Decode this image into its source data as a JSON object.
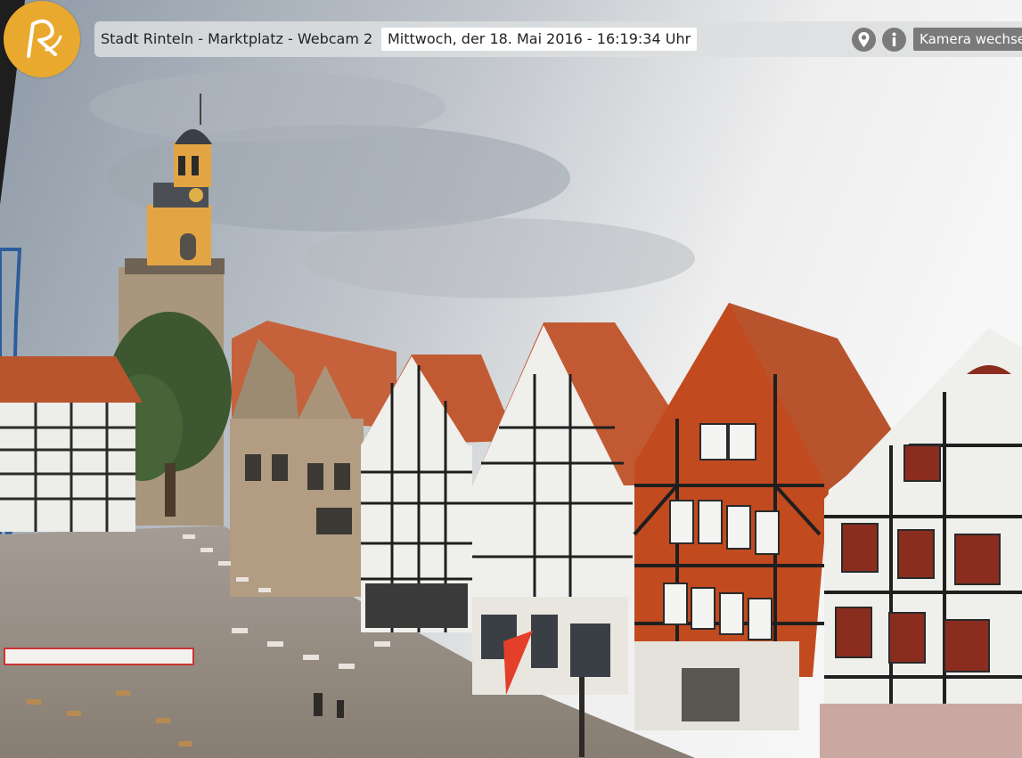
{
  "window": {
    "camera_title": "Stadt Rinteln - Marktplatz - Webcam 2",
    "timestamp": "Mittwoch, der 18. Mai 2016 - 16:19:34 Uhr"
  },
  "controls": {
    "switch_camera_label": "Kamera wechseln",
    "location_icon": "map-pin-icon",
    "info_icon": "info-icon"
  },
  "branding": {
    "logo_color": "#e9a92f"
  },
  "scene": {
    "sky_color": "#c9ccd0",
    "roof_color": "#b9542d",
    "timber_red": "#c24a1f",
    "pavement_color": "#9b938a"
  }
}
